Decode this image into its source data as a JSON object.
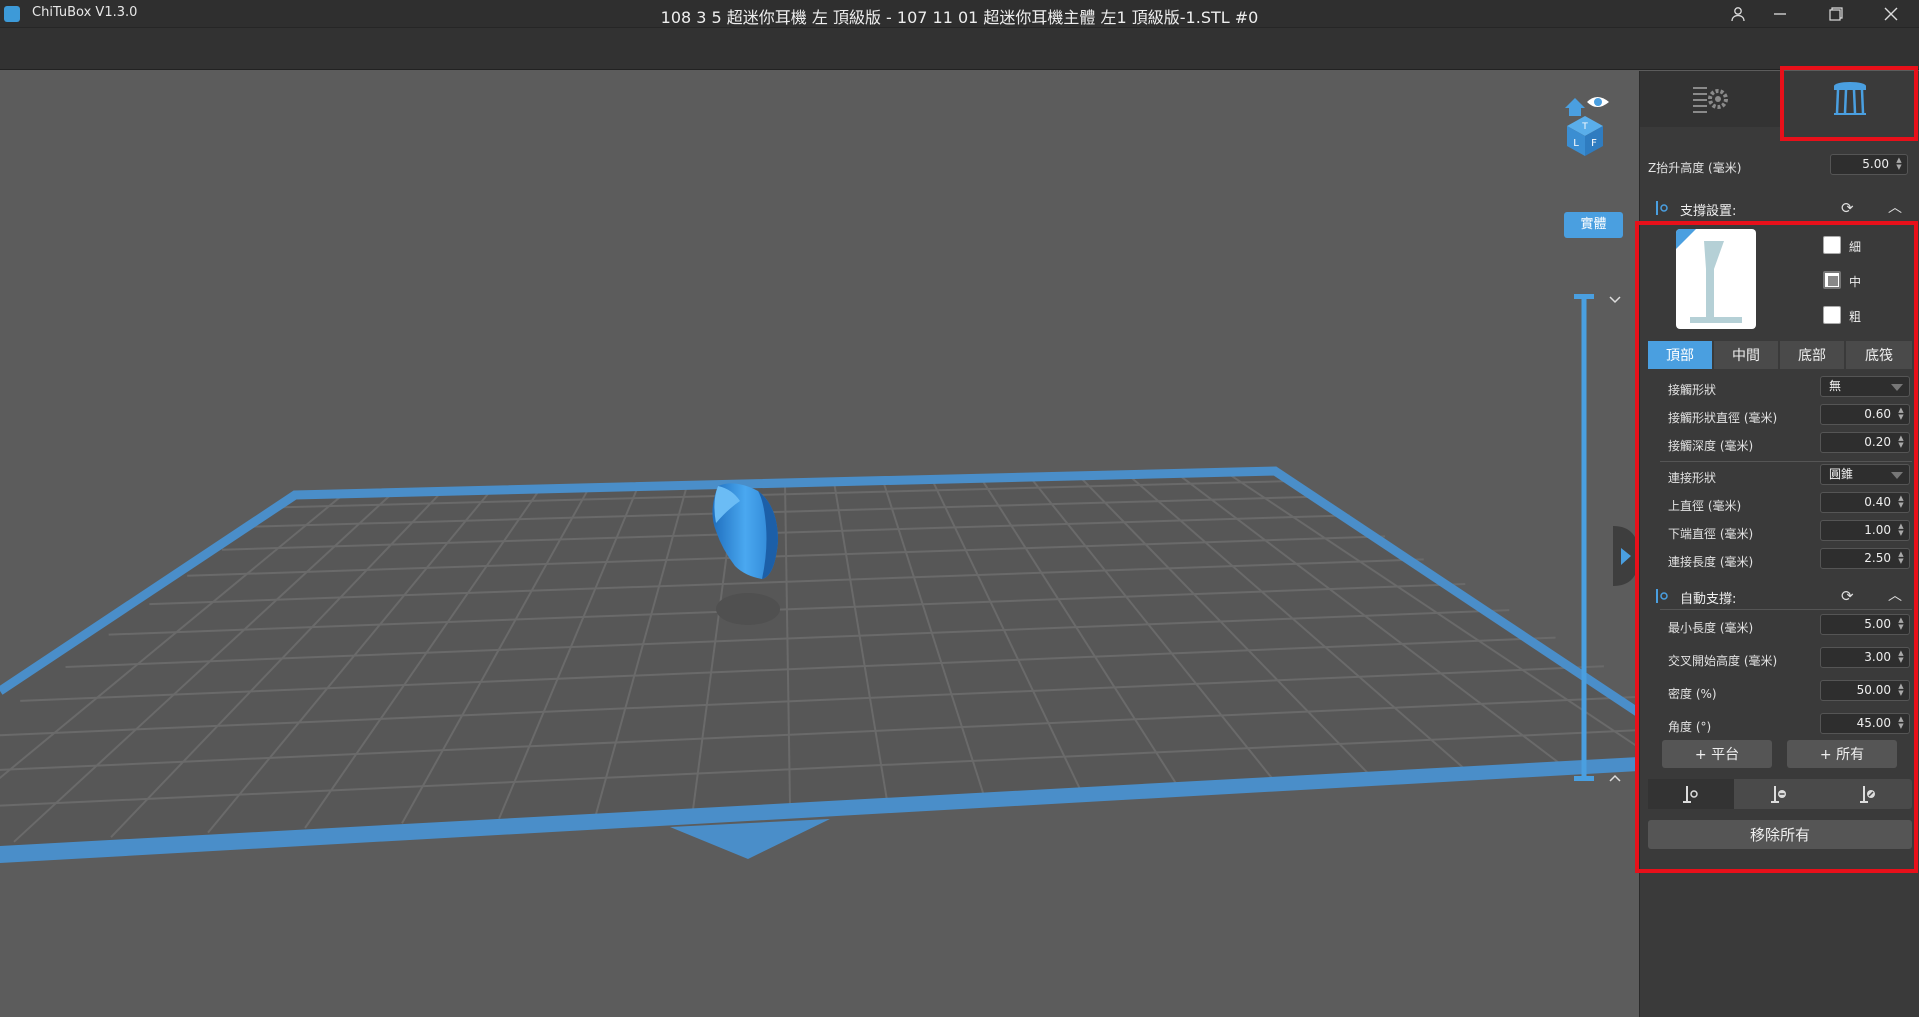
{
  "window": {
    "app_name": "ChiTuBox V1.3.0",
    "file_title": "108 3 5  超迷你耳機 左  頂級版 - 107 11 01  超迷你耳機主體 左1 頂級版-1.STL #0",
    "user_icon": "user-icon",
    "minimize_icon": "minimize-icon",
    "restore_icon": "restore-icon",
    "close_icon": "close-icon"
  },
  "viewport": {
    "view_mode_label": "實體",
    "cube_faces": [
      "T",
      "L",
      "F"
    ]
  },
  "panel": {
    "tabs": [
      {
        "name": "settings",
        "icon": "list-gear-icon"
      },
      {
        "name": "support",
        "icon": "support-table-icon"
      }
    ],
    "z_lift": {
      "label": "Z抬升高度 (毫米)",
      "value": "5.00"
    },
    "support_settings": {
      "title": "支撐設置:",
      "sizes": [
        {
          "label": "細",
          "checked": false
        },
        {
          "label": "中",
          "checked": true
        },
        {
          "label": "粗",
          "checked": false
        }
      ],
      "subtabs": [
        "頂部",
        "中間",
        "底部",
        "底筏"
      ],
      "active_subtab": 0,
      "fields": [
        {
          "label": "接觸形狀",
          "type": "select",
          "value": "無"
        },
        {
          "label": "接觸形狀直徑 (毫米)",
          "type": "number",
          "value": "0.60"
        },
        {
          "label": "接觸深度 (毫米)",
          "type": "number",
          "value": "0.20"
        },
        {
          "label": "連接形狀",
          "type": "select",
          "value": "圓錐"
        },
        {
          "label": "上直徑 (毫米)",
          "type": "number",
          "value": "0.40"
        },
        {
          "label": "下端直徑 (毫米)",
          "type": "number",
          "value": "1.00"
        },
        {
          "label": "連接長度 (毫米)",
          "type": "number",
          "value": "2.50"
        }
      ]
    },
    "auto_support": {
      "title": "自動支撐:",
      "fields": [
        {
          "label": "最小長度 (毫米)",
          "value": "5.00"
        },
        {
          "label": "交叉開始高度 (毫米)",
          "value": "3.00"
        },
        {
          "label": "密度 (%)",
          "value": "50.00"
        },
        {
          "label": "角度 (°)",
          "value": "45.00"
        }
      ],
      "add_platform": "+ 平台",
      "add_all": "+ 所有",
      "tools": [
        "add-support-icon",
        "remove-support-icon",
        "edit-support-icon"
      ],
      "remove_all": "移除所有"
    }
  },
  "colors": {
    "accent": "#4a9fe0",
    "highlight": "#e8101a",
    "model": "#3a8fd6",
    "plate_border": "#4a8ec9",
    "grid": "#525252"
  }
}
